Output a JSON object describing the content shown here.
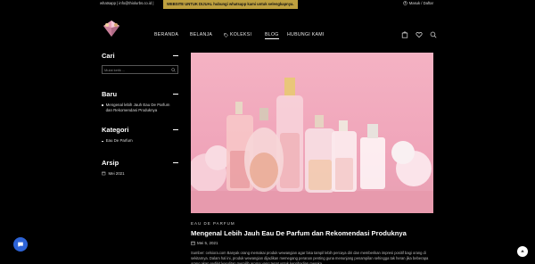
{
  "topbar": {
    "contact": "whatsapp | info@thiolurbs.co.id |",
    "promo": "WEBSITE UNTUK DIJUAL hubungi whatsapp kami untuk selengkapnya.",
    "account": "Masuk / Daftar"
  },
  "nav": {
    "items": [
      {
        "label": "BERANDA"
      },
      {
        "label": "BELANJA"
      },
      {
        "label": "KOLEKSI"
      },
      {
        "label": "BLOG"
      },
      {
        "label": "HUBUNGI KAMI"
      }
    ],
    "active": "BLOG"
  },
  "sidebar": {
    "search": {
      "title": "Cari",
      "placeholder": "Mulai ketik ..."
    },
    "recent": {
      "title": "Baru",
      "items": [
        "Mengenal lebih Jauh Eau De Parfum",
        "dan Rekomendasi Produknya"
      ]
    },
    "categories": {
      "title": "Kategori",
      "items": [
        "Eau De Parfum"
      ]
    },
    "archive": {
      "title": "Arsip",
      "items": [
        "Mei 2021"
      ]
    }
  },
  "post": {
    "category": "EAU DE PARFUM",
    "title": "Mengenal Lebih Jauh Eau De Parfum dan Rekomendasi Produknya",
    "date": "Mei 5, 2021",
    "excerpt": "Sumber: celsiora.com Banyak orang memakai produk wewangian agar bisa tampil lebih percaya diri dan memberikan impresi positif bagi orang di sekitarnya. Dalam hal ini, produk wewangian dijadikan memegang peranan penting guna menunjang penampilan sehingga tak heran jika beberapa orang akan sedikit kesulitan memilih aroma yang tepat untuk kepribadian mereka."
  },
  "colors": {
    "background": "#000000",
    "promo": "#bfa13f",
    "chat": "#2d63d6",
    "hero_pink": "#f0a5ba"
  }
}
